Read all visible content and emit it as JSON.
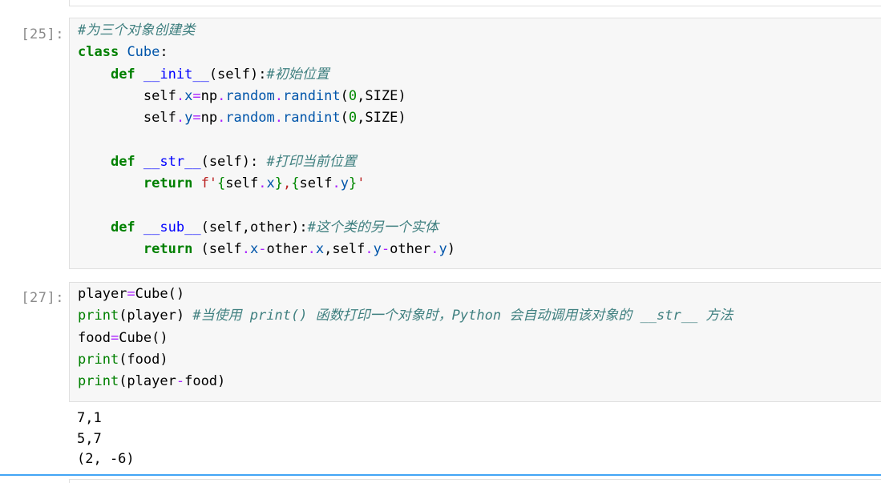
{
  "cells": [
    {
      "prompt": "[25]:",
      "lines": [
        [
          {
            "t": "cm",
            "v": "#为三个对象创建类"
          }
        ],
        [
          {
            "t": "kw",
            "v": "class"
          },
          {
            "t": "",
            "v": " "
          },
          {
            "t": "cls",
            "v": "Cube"
          },
          {
            "t": "",
            "v": ":"
          }
        ],
        [
          {
            "t": "",
            "v": "    "
          },
          {
            "t": "kw",
            "v": "def"
          },
          {
            "t": "",
            "v": " "
          },
          {
            "t": "fn",
            "v": "__init__"
          },
          {
            "t": "",
            "v": "(self):"
          },
          {
            "t": "cm",
            "v": "#初始位置"
          }
        ],
        [
          {
            "t": "",
            "v": "        self"
          },
          {
            "t": "op",
            "v": "."
          },
          {
            "t": "attr",
            "v": "x"
          },
          {
            "t": "op",
            "v": "="
          },
          {
            "t": "",
            "v": "np"
          },
          {
            "t": "op",
            "v": "."
          },
          {
            "t": "attr",
            "v": "random"
          },
          {
            "t": "op",
            "v": "."
          },
          {
            "t": "attr",
            "v": "randint"
          },
          {
            "t": "",
            "v": "("
          },
          {
            "t": "num",
            "v": "0"
          },
          {
            "t": "",
            "v": ",SIZE)"
          }
        ],
        [
          {
            "t": "",
            "v": "        self"
          },
          {
            "t": "op",
            "v": "."
          },
          {
            "t": "attr",
            "v": "y"
          },
          {
            "t": "op",
            "v": "="
          },
          {
            "t": "",
            "v": "np"
          },
          {
            "t": "op",
            "v": "."
          },
          {
            "t": "attr",
            "v": "random"
          },
          {
            "t": "op",
            "v": "."
          },
          {
            "t": "attr",
            "v": "randint"
          },
          {
            "t": "",
            "v": "("
          },
          {
            "t": "num",
            "v": "0"
          },
          {
            "t": "",
            "v": ",SIZE)"
          }
        ],
        [],
        [
          {
            "t": "",
            "v": "    "
          },
          {
            "t": "kw",
            "v": "def"
          },
          {
            "t": "",
            "v": " "
          },
          {
            "t": "fn",
            "v": "__str__"
          },
          {
            "t": "",
            "v": "(self): "
          },
          {
            "t": "cm",
            "v": "#打印当前位置"
          }
        ],
        [
          {
            "t": "",
            "v": "        "
          },
          {
            "t": "kw",
            "v": "return"
          },
          {
            "t": "",
            "v": " "
          },
          {
            "t": "str",
            "v": "f'"
          },
          {
            "t": "num",
            "v": "{"
          },
          {
            "t": "",
            "v": "self"
          },
          {
            "t": "op",
            "v": "."
          },
          {
            "t": "attr",
            "v": "x"
          },
          {
            "t": "num",
            "v": "}"
          },
          {
            "t": "str",
            "v": ","
          },
          {
            "t": "num",
            "v": "{"
          },
          {
            "t": "",
            "v": "self"
          },
          {
            "t": "op",
            "v": "."
          },
          {
            "t": "attr",
            "v": "y"
          },
          {
            "t": "num",
            "v": "}"
          },
          {
            "t": "str",
            "v": "'"
          }
        ],
        [],
        [
          {
            "t": "",
            "v": "    "
          },
          {
            "t": "kw",
            "v": "def"
          },
          {
            "t": "",
            "v": " "
          },
          {
            "t": "fn",
            "v": "__sub__"
          },
          {
            "t": "",
            "v": "(self,other):"
          },
          {
            "t": "cm",
            "v": "#这个类的另一个实体"
          }
        ],
        [
          {
            "t": "",
            "v": "        "
          },
          {
            "t": "kw",
            "v": "return"
          },
          {
            "t": "",
            "v": " (self"
          },
          {
            "t": "op",
            "v": "."
          },
          {
            "t": "attr",
            "v": "x"
          },
          {
            "t": "op",
            "v": "-"
          },
          {
            "t": "",
            "v": "other"
          },
          {
            "t": "op",
            "v": "."
          },
          {
            "t": "attr",
            "v": "x"
          },
          {
            "t": "",
            "v": ",self"
          },
          {
            "t": "op",
            "v": "."
          },
          {
            "t": "attr",
            "v": "y"
          },
          {
            "t": "op",
            "v": "-"
          },
          {
            "t": "",
            "v": "other"
          },
          {
            "t": "op",
            "v": "."
          },
          {
            "t": "attr",
            "v": "y"
          },
          {
            "t": "",
            "v": ")"
          }
        ]
      ],
      "output": []
    },
    {
      "prompt": "[27]:",
      "lines": [
        [
          {
            "t": "",
            "v": "player"
          },
          {
            "t": "op",
            "v": "="
          },
          {
            "t": "",
            "v": "Cube()"
          }
        ],
        [
          {
            "t": "bi",
            "v": "print"
          },
          {
            "t": "",
            "v": "(player) "
          },
          {
            "t": "cm",
            "v": "#当使用 print() 函数打印一个对象时，Python 会自动调用该对象的 __str__ 方法"
          }
        ],
        [
          {
            "t": "",
            "v": "food"
          },
          {
            "t": "op",
            "v": "="
          },
          {
            "t": "",
            "v": "Cube()"
          }
        ],
        [
          {
            "t": "bi",
            "v": "print"
          },
          {
            "t": "",
            "v": "(food)"
          }
        ],
        [
          {
            "t": "bi",
            "v": "print"
          },
          {
            "t": "",
            "v": "(player"
          },
          {
            "t": "op",
            "v": "-"
          },
          {
            "t": "",
            "v": "food)"
          }
        ]
      ],
      "output": [
        "7,1",
        "5,7",
        "(2, -6)"
      ]
    }
  ]
}
